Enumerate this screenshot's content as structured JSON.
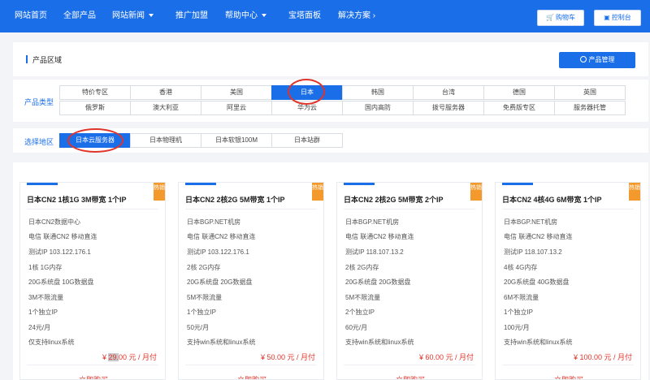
{
  "nav": {
    "items": [
      {
        "label": "网站首页",
        "caret": false
      },
      {
        "label": "全部产品",
        "caret": false
      },
      {
        "label": "网站新闻",
        "caret": true
      },
      {
        "label": "推广加盟",
        "caret": false
      },
      {
        "label": "帮助中心",
        "caret": true
      },
      {
        "label": "宝塔面板",
        "caret": false
      },
      {
        "label": "解决方案 ›",
        "caret": false
      }
    ],
    "cart_label": "购物车",
    "console_label": "控制台"
  },
  "header": {
    "title": "产品区域",
    "manage_label": "产品管理"
  },
  "product_type": {
    "label": "产品类型",
    "row1": [
      "特价专区",
      "香港",
      "美国",
      "日本",
      "韩国",
      "台湾",
      "德国",
      "英国"
    ],
    "row2": [
      "俄罗斯",
      "澳大利亚",
      "阿里云",
      "华为云",
      "国内高防",
      "拨号服务器",
      "免费版专区",
      "服务器托管"
    ],
    "active": "日本"
  },
  "region": {
    "label": "选择地区",
    "items": [
      "日本云服务器",
      "日本物理机",
      "日本软银100M",
      "日本站群"
    ],
    "active": "日本云服务器"
  },
  "cards": [
    {
      "title": "日本CN2 1核1G 3M带宽 1个IP",
      "badge": "热销",
      "specs": [
        "日本CN2数据中心",
        "电信 联通CN2 移动直连",
        "测试IP 103.122.176.1",
        "1核 1G内存",
        "20G系统盘 10G数据盘",
        "3M不限流量",
        "1个独立IP",
        "24元/月",
        "仅支持linux系统"
      ],
      "price_prefix": "¥ ",
      "price_highlight": "29.",
      "price_suffix": "00 元 / 月付",
      "buy": "立即购买"
    },
    {
      "title": "日本CN2 2核2G 5M带宽 1个IP",
      "badge": "热销",
      "specs": [
        "日本BGP.NET机房",
        "电信 联通CN2 移动直连",
        "测试IP 103.122.176.1",
        "2核 2G内存",
        "20G系统盘 20G数据盘",
        "5M不限流量",
        "1个独立IP",
        "50元/月",
        "支持win系统和linux系统"
      ],
      "price_prefix": "¥ ",
      "price_highlight": "",
      "price_suffix": "50.00 元 / 月付",
      "buy": "立即购买"
    },
    {
      "title": "日本CN2 2核2G 5M带宽 2个IP",
      "badge": "热销",
      "specs": [
        "日本BGP.NET机房",
        "电信 联通CN2 移动直连",
        "测试IP 118.107.13.2",
        "2核 2G内存",
        "20G系统盘 20G数据盘",
        "5M不限流量",
        "2个独立IP",
        "60元/月",
        "支持win系统和linux系统"
      ],
      "price_prefix": "¥ ",
      "price_highlight": "",
      "price_suffix": "60.00 元 / 月付",
      "buy": "立即购买"
    },
    {
      "title": "日本CN2 4核4G 6M带宽 1个IP",
      "badge": "热销",
      "specs": [
        "日本BGP.NET机房",
        "电信 联通CN2 移动直连",
        "测试IP 118.107.13.2",
        "4核 4G内存",
        "20G系统盘 40G数据盘",
        "6M不限流量",
        "1个独立IP",
        "100元/月",
        "支持win系统和linux系统"
      ],
      "price_prefix": "¥ ",
      "price_highlight": "",
      "price_suffix": "100.00 元 / 月付",
      "buy": "立即购买"
    }
  ],
  "colors": {
    "brand": "#1a6ee8",
    "accent_red": "#e0342a",
    "hot_badge": "#f49a2c"
  }
}
